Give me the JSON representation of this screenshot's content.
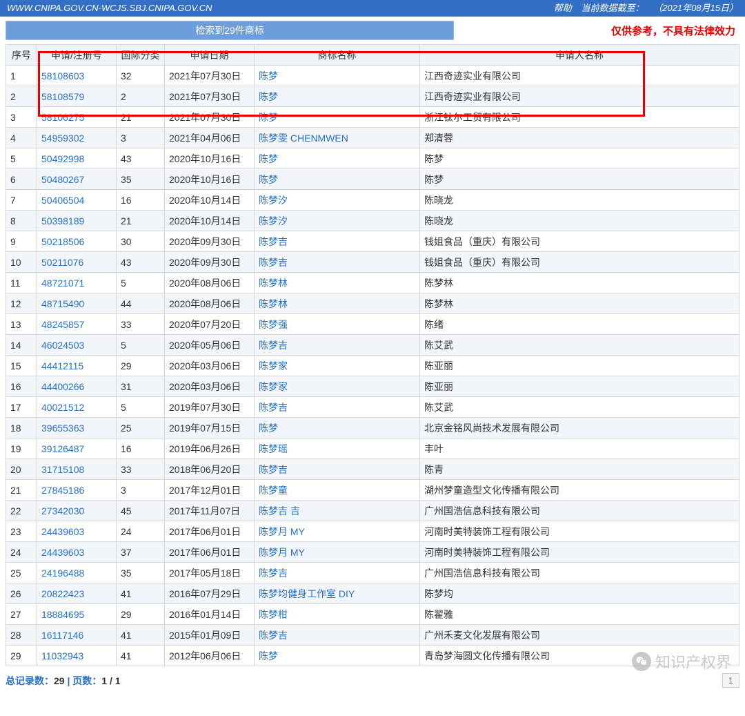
{
  "topbar": {
    "url": "WWW.CNIPA.GOV.CN·WCJS.SBJ.CNIPA.GOV.CN",
    "help": "帮助",
    "data_label": "当前数据截至：",
    "data_date": "（2021年08月15日）"
  },
  "summary": "检索到29件商标",
  "disclaimer": "仅供参考，不具有法律效力",
  "columns": {
    "seq": "序号",
    "reg": "申请/注册号",
    "cls": "国际分类",
    "date": "申请日期",
    "name": "商标名称",
    "applicant": "申请人名称"
  },
  "rows": [
    {
      "seq": "1",
      "reg": "58108603",
      "cls": "32",
      "date": "2021年07月30日",
      "name": "陈梦",
      "applicant": "江西奇迹实业有限公司"
    },
    {
      "seq": "2",
      "reg": "58108579",
      "cls": "2",
      "date": "2021年07月30日",
      "name": "陈梦",
      "applicant": "江西奇迹实业有限公司"
    },
    {
      "seq": "3",
      "reg": "58106275",
      "cls": "21",
      "date": "2021年07月30日",
      "name": "陈梦",
      "applicant": "浙江钛尔工贸有限公司"
    },
    {
      "seq": "4",
      "reg": "54959302",
      "cls": "3",
      "date": "2021年04月06日",
      "name": "陈梦雯 CHENMWEN",
      "applicant": "郑清蓉"
    },
    {
      "seq": "5",
      "reg": "50492998",
      "cls": "43",
      "date": "2020年10月16日",
      "name": "陈梦",
      "applicant": "陈梦"
    },
    {
      "seq": "6",
      "reg": "50480267",
      "cls": "35",
      "date": "2020年10月16日",
      "name": "陈梦",
      "applicant": "陈梦"
    },
    {
      "seq": "7",
      "reg": "50406504",
      "cls": "16",
      "date": "2020年10月14日",
      "name": "陈梦汐",
      "applicant": "陈晓龙"
    },
    {
      "seq": "8",
      "reg": "50398189",
      "cls": "21",
      "date": "2020年10月14日",
      "name": "陈梦汐",
      "applicant": "陈晓龙"
    },
    {
      "seq": "9",
      "reg": "50218506",
      "cls": "30",
      "date": "2020年09月30日",
      "name": "陈梦吉",
      "applicant": "钱姐食品（重庆）有限公司"
    },
    {
      "seq": "10",
      "reg": "50211076",
      "cls": "43",
      "date": "2020年09月30日",
      "name": "陈梦吉",
      "applicant": "钱姐食品（重庆）有限公司"
    },
    {
      "seq": "11",
      "reg": "48721071",
      "cls": "5",
      "date": "2020年08月06日",
      "name": "陈梦林",
      "applicant": "陈梦林"
    },
    {
      "seq": "12",
      "reg": "48715490",
      "cls": "44",
      "date": "2020年08月06日",
      "name": "陈梦林",
      "applicant": "陈梦林"
    },
    {
      "seq": "13",
      "reg": "48245857",
      "cls": "33",
      "date": "2020年07月20日",
      "name": "陈梦强",
      "applicant": "陈绪"
    },
    {
      "seq": "14",
      "reg": "46024503",
      "cls": "5",
      "date": "2020年05月06日",
      "name": "陈梦吉",
      "applicant": "陈艾武"
    },
    {
      "seq": "15",
      "reg": "44412115",
      "cls": "29",
      "date": "2020年03月06日",
      "name": "陈梦家",
      "applicant": "陈亚丽"
    },
    {
      "seq": "16",
      "reg": "44400266",
      "cls": "31",
      "date": "2020年03月06日",
      "name": "陈梦家",
      "applicant": "陈亚丽"
    },
    {
      "seq": "17",
      "reg": "40021512",
      "cls": "5",
      "date": "2019年07月30日",
      "name": "陈梦吉",
      "applicant": "陈艾武"
    },
    {
      "seq": "18",
      "reg": "39655363",
      "cls": "25",
      "date": "2019年07月15日",
      "name": "陈梦",
      "applicant": "北京金铭风尚技术发展有限公司"
    },
    {
      "seq": "19",
      "reg": "39126487",
      "cls": "16",
      "date": "2019年06月26日",
      "name": "陈梦瑶",
      "applicant": "丰叶"
    },
    {
      "seq": "20",
      "reg": "31715108",
      "cls": "33",
      "date": "2018年06月20日",
      "name": "陈梦吉",
      "applicant": "陈青"
    },
    {
      "seq": "21",
      "reg": "27845186",
      "cls": "3",
      "date": "2017年12月01日",
      "name": "陈梦童",
      "applicant": "湖州梦童造型文化传播有限公司"
    },
    {
      "seq": "22",
      "reg": "27342030",
      "cls": "45",
      "date": "2017年11月07日",
      "name": "陈梦吉 吉",
      "applicant": "广州国浩信息科技有限公司"
    },
    {
      "seq": "23",
      "reg": "24439603",
      "cls": "24",
      "date": "2017年06月01日",
      "name": "陈梦月 MY",
      "applicant": "河南时美特装饰工程有限公司"
    },
    {
      "seq": "24",
      "reg": "24439603",
      "cls": "37",
      "date": "2017年06月01日",
      "name": "陈梦月 MY",
      "applicant": "河南时美特装饰工程有限公司"
    },
    {
      "seq": "25",
      "reg": "24196488",
      "cls": "35",
      "date": "2017年05月18日",
      "name": "陈梦吉",
      "applicant": "广州国浩信息科技有限公司"
    },
    {
      "seq": "26",
      "reg": "20822423",
      "cls": "41",
      "date": "2016年07月29日",
      "name": "陈梦均健身工作室 DIY",
      "applicant": "陈梦均"
    },
    {
      "seq": "27",
      "reg": "18884695",
      "cls": "29",
      "date": "2016年01月14日",
      "name": "陈梦柑",
      "applicant": "陈翟雅"
    },
    {
      "seq": "28",
      "reg": "16117146",
      "cls": "41",
      "date": "2015年01月09日",
      "name": "陈梦吉",
      "applicant": "广州禾麦文化发展有限公司"
    },
    {
      "seq": "29",
      "reg": "11032943",
      "cls": "41",
      "date": "2012年06月06日",
      "name": "陈梦",
      "applicant": "青岛梦海圆文化传播有限公司"
    }
  ],
  "footer": {
    "total_label": "总记录数：",
    "total_value": "29",
    "sep": " | ",
    "pages_label": "页数：",
    "pages_value": "1 / 1",
    "page_indicator": "1"
  },
  "watermark": "知识产权界"
}
